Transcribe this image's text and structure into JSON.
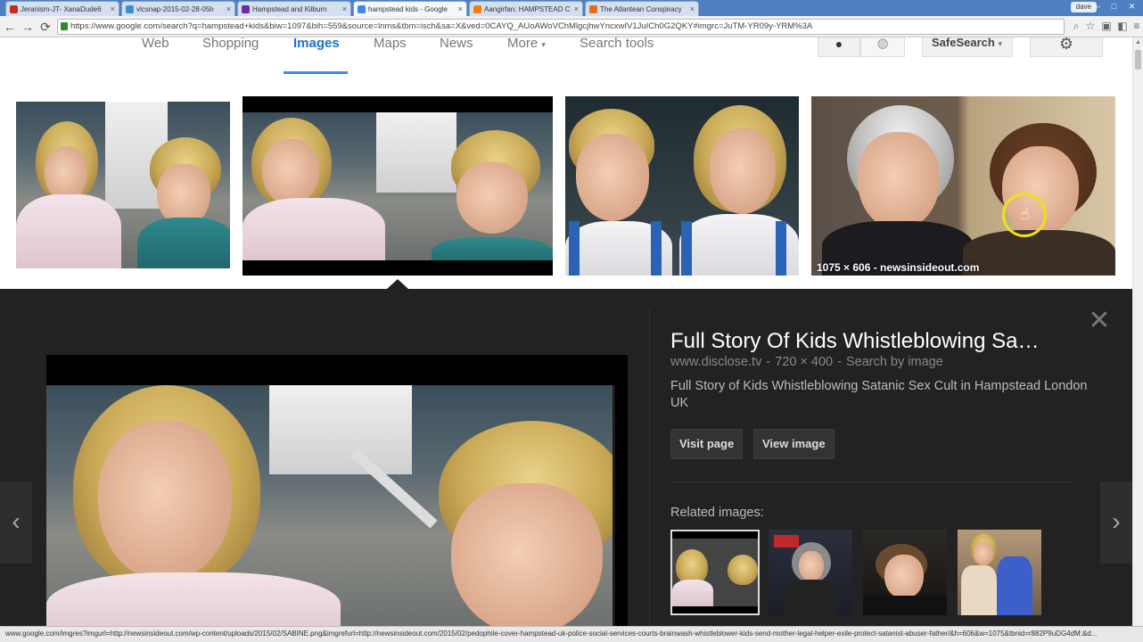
{
  "browser": {
    "tabs": [
      {
        "title": "Jeranism-JT- XanaDude6",
        "favicon_color": "#cc2a1f",
        "active": false
      },
      {
        "title": "vlcsnap-2015-02-28-05h",
        "favicon_color": "#3b8fd0",
        "active": false
      },
      {
        "title": "Hampstead and Kilburn",
        "favicon_color": "#6b2fa3",
        "active": false
      },
      {
        "title": "hampstead kids - Google",
        "favicon_color": "#4285f4",
        "active": true
      },
      {
        "title": "Aangirfan: HAMPSTEAD C",
        "favicon_color": "#f57d00",
        "active": false
      },
      {
        "title": "The Atlantean Conspiracy",
        "favicon_color": "#e46d20",
        "active": false
      }
    ],
    "tab_close": "×",
    "user": "dave",
    "window_controls": {
      "minimize": "–",
      "maximize": "□",
      "close": "✕"
    },
    "nav": {
      "back": "←",
      "forward": "→",
      "reload": "⟳"
    },
    "url": "https://www.google.com/search?q=hampstead+kids&biw=1097&bih=559&source=lnms&tbm=isch&sa=X&ved=0CAYQ_AUoAWoVChMlgcjhwYncxwIV1JuICh0G2QKY#imgrc=JuTM-YR09y-YRM%3A",
    "toolbar_icons": [
      "magnifier-icon",
      "star-icon",
      "extension-icon",
      "menu-icon"
    ]
  },
  "google_nav": {
    "tabs": [
      {
        "label": "Web",
        "active": false
      },
      {
        "label": "Shopping",
        "active": false
      },
      {
        "label": "Images",
        "active": true
      },
      {
        "label": "Maps",
        "active": false
      },
      {
        "label": "News",
        "active": false
      },
      {
        "label": "More",
        "active": false
      },
      {
        "label": "Search tools",
        "active": false
      }
    ],
    "more_caret": "▾",
    "account_icon": "●",
    "globe_icon": "◍",
    "safesearch": "SafeSearch",
    "safesearch_caret": "▾",
    "settings_icon": "⚙"
  },
  "thumbnails": {
    "items": [
      {
        "subject": "girl-and-boy-in-parking-lot"
      },
      {
        "subject": "girl-and-boy-selected"
      },
      {
        "subject": "boy-and-girl-closeup"
      },
      {
        "subject": "elderly-man-and-woman-webcam",
        "caption": "1075 × 606 - newsinsideout.com"
      }
    ]
  },
  "viewer": {
    "title": "Full Story Of Kids Whistleblowing Sa…",
    "domain": "www.disclose.tv",
    "separator": "-",
    "dimensions": "720 × 400",
    "search_by_image": "Search by image",
    "description": "Full Story of Kids Whistleblowing Satanic Sex Cult in Hampstead London UK",
    "visit_page": "Visit page",
    "view_image": "View image",
    "related_label": "Related images:",
    "close_icon": "✕",
    "prev_icon": "‹",
    "next_icon": "›"
  },
  "status_bar": {
    "text": "www.google.com/imgres?imgurl=http://newsinsideout.com/wp-content/uploads/2015/02/SABINE.png&imgrefurl=http://newsinsideout.com/2015/02/pedophile-cover-hampstead-uk-police-social-services-courts-brainwash-whistleblower-kids-send-mother-legal-helper-exile-protect-satanist-abuser-father/&h=606&w=1075&tbnid=r882P9uDG4dM:&d..."
  },
  "colors": {
    "google_blue": "#1a73c8",
    "viewer_bg": "#222222",
    "cursor_highlight": "#f5df1c"
  }
}
